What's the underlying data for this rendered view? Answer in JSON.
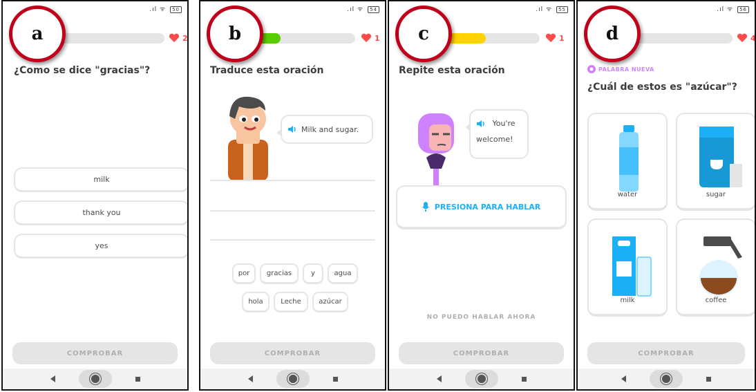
{
  "panels": {
    "a": {
      "badge": "a",
      "hearts": "2",
      "progress": 0.05,
      "prompt": "¿Como se dice \"gracias\"?",
      "options": [
        "milk",
        "thank you",
        "yes"
      ],
      "check_label": "COMPROBAR"
    },
    "b": {
      "badge": "b",
      "hearts": "1",
      "progress": 0.4,
      "prompt": "Traduce esta oración",
      "bubble_text": "Milk and sugar.",
      "word_bank_row1": [
        "por",
        "gracias",
        "y",
        "agua"
      ],
      "word_bank_row2": [
        "hola",
        "Leche",
        "azúcar"
      ],
      "check_label": "COMPROBAR"
    },
    "c": {
      "badge": "c",
      "hearts": "1",
      "progress": 0.55,
      "prompt": "Repite esta oración",
      "bubble_line1": "You're",
      "bubble_line2": "welcome!",
      "speak_label": "PRESIONA PARA HABLAR",
      "cant_speak_label": "NO PUEDO HABLAR AHORA",
      "check_label": "COMPROBAR"
    },
    "d": {
      "badge": "d",
      "hearts": "4",
      "progress": 0.08,
      "new_word_label": "PALABRA NUEVA",
      "prompt": "¿Cuál de estos es \"azúcar\"?",
      "cards": [
        "water",
        "sugar",
        "milk",
        "coffee"
      ],
      "check_label": "COMPROBAR"
    }
  },
  "colors": {
    "green": "#58cc02",
    "yellow": "#ffd300",
    "red_heart": "#ff4b4b",
    "blue": "#1cb0f6",
    "purple": "#ce82ff",
    "badge_ring": "#c0001b"
  },
  "icons": [
    "heart-icon",
    "speaker-icon",
    "microphone-icon",
    "new-word-icon",
    "back-icon",
    "home-icon",
    "recents-icon"
  ]
}
